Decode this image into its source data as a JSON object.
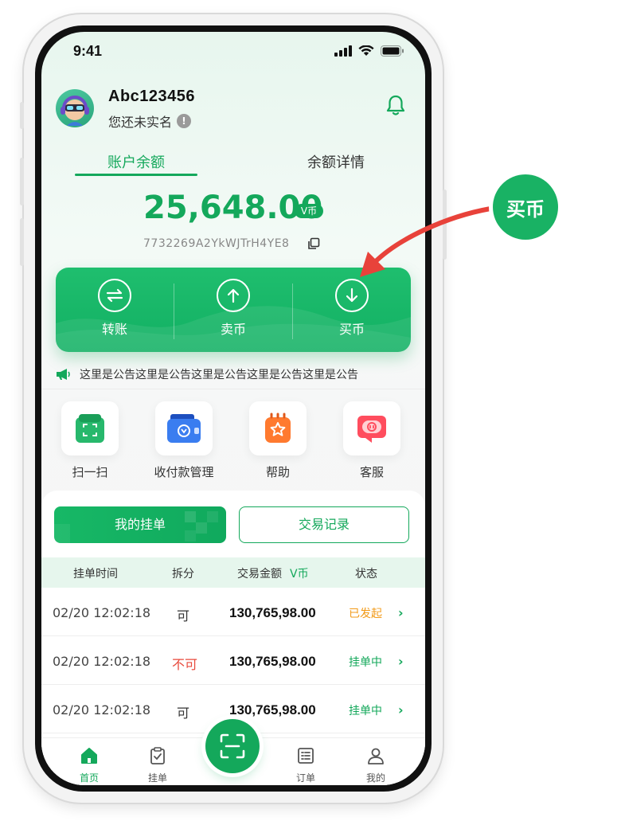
{
  "status_bar": {
    "time": "9:41"
  },
  "user": {
    "name": "Abc123456",
    "verify_text": "您还未实名",
    "verify_badge": "!"
  },
  "balance_tabs": [
    {
      "label": "账户余额"
    },
    {
      "label": "余额详情"
    }
  ],
  "balance": {
    "amount": "25,648.00",
    "unit": "V币",
    "address": "7732269A2YkWJTrH4YE8"
  },
  "actions": [
    {
      "label": "转账",
      "icon": "transfer-icon"
    },
    {
      "label": "卖币",
      "icon": "arrow-up-circle-icon"
    },
    {
      "label": "买币",
      "icon": "arrow-down-circle-icon"
    }
  ],
  "notice": {
    "text": "这里是公告这里是公告这里是公告这里是公告这里是公告"
  },
  "quick_actions": [
    {
      "label": "扫一扫",
      "icon": "scan-icon"
    },
    {
      "label": "收付款管理",
      "icon": "wallet-icon"
    },
    {
      "label": "帮助",
      "icon": "help-star-icon"
    },
    {
      "label": "客服",
      "icon": "customer-service-icon"
    }
  ],
  "orders": {
    "tab_active": "我的挂单",
    "tab_idle": "交易记录",
    "columns": {
      "time": "挂单时间",
      "split": "拆分",
      "amount": "交易金额",
      "amount_unit": "V币",
      "status": "状态"
    },
    "rows": [
      {
        "time": "02/20 12:02:18",
        "split": "可",
        "amount": "130,765,98.00",
        "status": "已发起",
        "status_color": "#f29a18",
        "split_color": "#333333"
      },
      {
        "time": "02/20 12:02:18",
        "split": "不可",
        "amount": "130,765,98.00",
        "status": "挂单中",
        "status_color": "#14a85b",
        "split_color": "#e84a3c"
      },
      {
        "time": "02/20 12:02:18",
        "split": "可",
        "amount": "130,765,98.00",
        "status": "挂单中",
        "status_color": "#14a85b",
        "split_color": "#333333"
      }
    ]
  },
  "bottom_nav": [
    {
      "label": "首页",
      "icon": "home-icon",
      "active": true
    },
    {
      "label": "挂单",
      "icon": "clipboard-icon",
      "active": false
    },
    {
      "label": "订单",
      "icon": "list-icon",
      "active": false
    },
    {
      "label": "我的",
      "icon": "profile-icon",
      "active": false
    }
  ],
  "callout": {
    "label": "买币"
  },
  "colors": {
    "brand": "#14a85b",
    "warning": "#f29a18",
    "danger": "#e84a3c",
    "callout_arrow": "#e8423a"
  }
}
